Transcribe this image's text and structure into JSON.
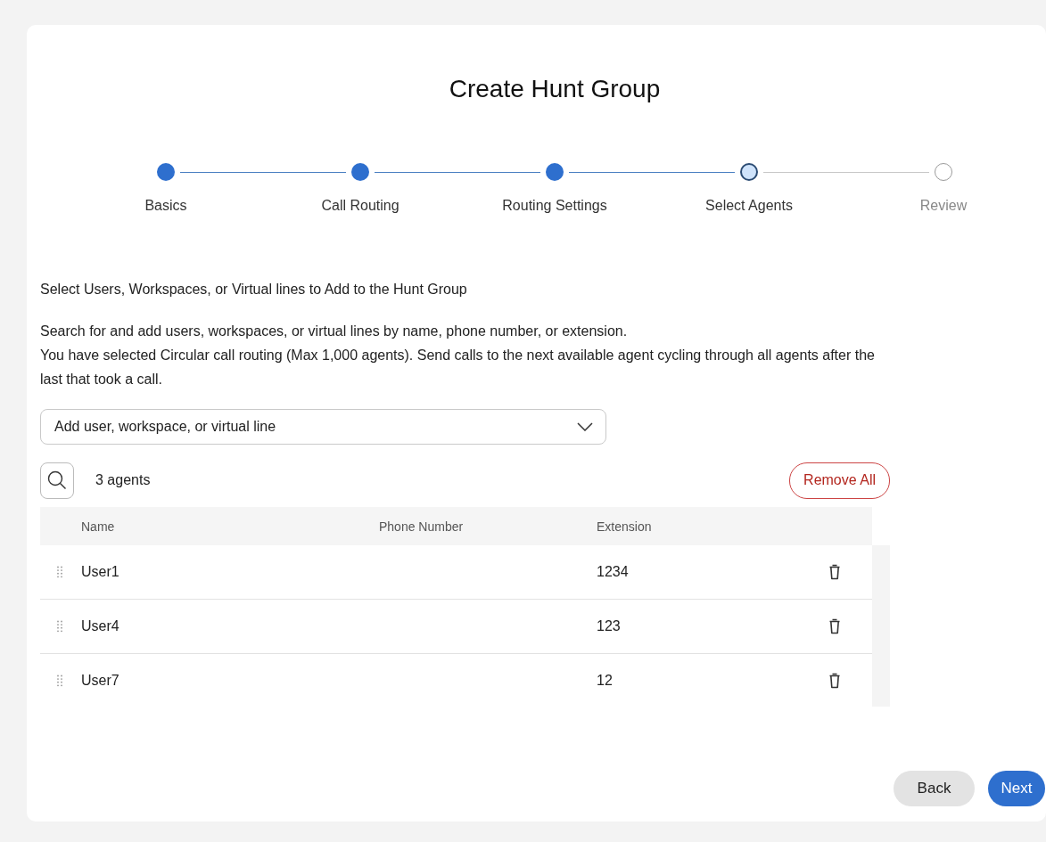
{
  "title": "Create Hunt Group",
  "steps": [
    {
      "label": "Basics",
      "completed": true,
      "current": false
    },
    {
      "label": "Call Routing",
      "completed": true,
      "current": false
    },
    {
      "label": "Routing Settings",
      "completed": true,
      "current": false
    },
    {
      "label": "Select Agents",
      "completed": false,
      "current": true
    },
    {
      "label": "Review",
      "completed": false,
      "current": false
    }
  ],
  "heading": "Select Users, Workspaces, or Virtual lines to Add to the Hunt Group",
  "description": [
    "Search for and add users, workspaces, or virtual lines by name, phone number, or extension.",
    "You have selected Circular call routing (Max 1,000 agents). Send calls to the next available agent cycling through all agents after the last that took a call."
  ],
  "add_dropdown": {
    "placeholder": "Add user, workspace, or virtual line"
  },
  "agent_count": "3 agents",
  "remove_all": "Remove All",
  "table": {
    "columns": [
      "Name",
      "Phone Number",
      "Extension"
    ],
    "rows": [
      {
        "name": "User1",
        "extension": "1234"
      },
      {
        "name": "User4",
        "extension": "123"
      },
      {
        "name": "User7",
        "extension": "12"
      }
    ]
  },
  "buttons": {
    "back": "Back",
    "next": "Next"
  }
}
